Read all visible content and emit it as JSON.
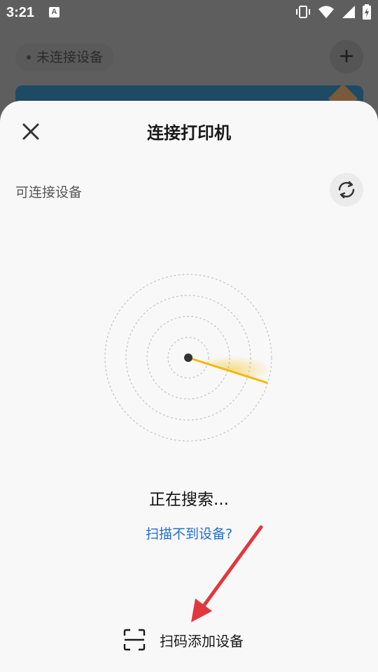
{
  "status_bar": {
    "time": "3:21",
    "notification_icon_letter": "A",
    "icons": [
      "vibrate-icon",
      "wifi-icon",
      "signal-icon",
      "battery-charging-icon"
    ]
  },
  "background": {
    "device_status": "未连接设备",
    "add_icon": "+"
  },
  "sheet": {
    "title": "连接打印机",
    "section_label": "可连接设备",
    "status_text": "正在搜索...",
    "help_link": "扫描不到设备?",
    "scan_label": "扫码添加设备"
  },
  "colors": {
    "link": "#1f6fd0",
    "radar_sweep": "#f5b800",
    "annotation_arrow": "#e0383e",
    "sheet_bg": "#f8f8f8"
  }
}
